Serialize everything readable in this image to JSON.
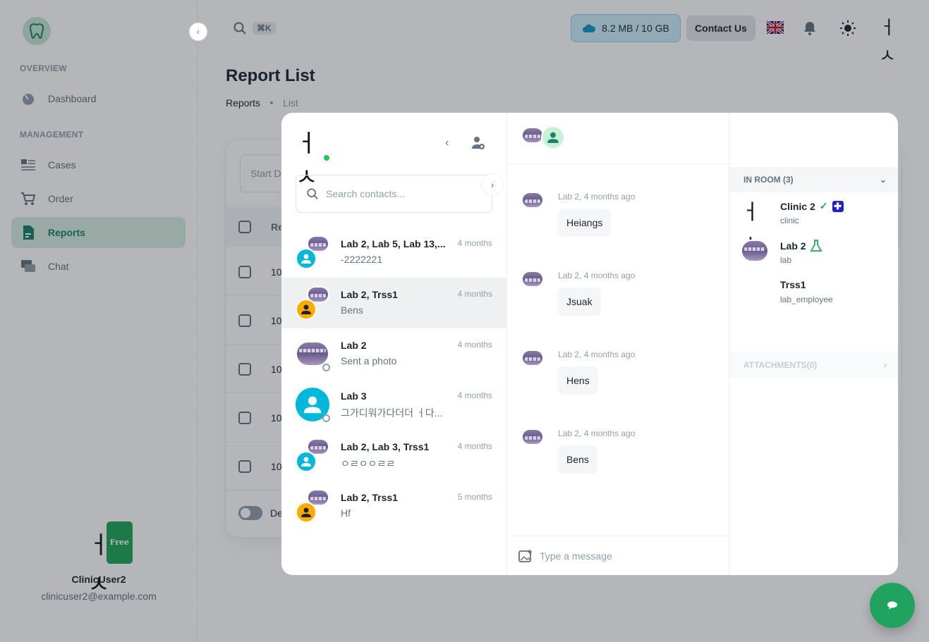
{
  "sidebar": {
    "logo_icon": "tooth-logo-icon",
    "sections": [
      {
        "label": "OVERVIEW"
      },
      {
        "label": "MANAGEMENT"
      }
    ],
    "items": [
      {
        "label": "Dashboard",
        "icon": "dashboard-icon"
      },
      {
        "label": "Cases",
        "icon": "cases-icon"
      },
      {
        "label": "Order",
        "icon": "cart-icon"
      },
      {
        "label": "Reports",
        "icon": "report-icon",
        "active": true
      },
      {
        "label": "Chat",
        "icon": "chat-icon"
      }
    ],
    "user": {
      "name": "ClinicUser2",
      "email": "clinicuser2@example.com",
      "plan_badge": "Free",
      "avatar_text": "ㅓㅅ"
    }
  },
  "topbar": {
    "shortcut": "⌘K",
    "storage": "8.2 MB / 10 GB",
    "contact_label": "Contact Us",
    "avatar_text": "ㅓㅅ"
  },
  "page": {
    "title": "Report List",
    "breadcrumb": [
      "Reports",
      "List"
    ],
    "filter_start_placeholder": "Start D",
    "header_col": "Re",
    "rows": [
      "10",
      "10",
      "10",
      "10",
      "10"
    ],
    "dense_label": "De"
  },
  "chat": {
    "me_avatar_text": "ㅓㅅ",
    "search_placeholder": "Search contacts...",
    "conversations": [
      {
        "name": "Lab 2, Lab 5, Lab 13,...",
        "last": "-2222221",
        "time": "4 months"
      },
      {
        "name": "Lab 2, Trss1",
        "last": "Bens",
        "time": "4 months"
      },
      {
        "name": "Lab 2",
        "last": "Sent a photo",
        "time": "4 months"
      },
      {
        "name": "Lab 3",
        "last": "그가디워가다더더 ㅓ다...",
        "time": "4 months"
      },
      {
        "name": "Lab 2, Lab 3, Trss1",
        "last": "ㅇㄹㅇㅇㄹㄹ",
        "time": "4 months"
      },
      {
        "name": "Lab 2, Trss1",
        "last": "Hf",
        "time": "5 months"
      }
    ],
    "messages": [
      {
        "meta": "Lab 2,  4 months ago",
        "text": "Heiangs"
      },
      {
        "meta": "Lab 2,  4 months ago",
        "text": "Jsuak"
      },
      {
        "meta": "Lab 2,  4 months ago",
        "text": "Hens"
      },
      {
        "meta": "Lab 2,  4 months ago",
        "text": "Bens"
      }
    ],
    "input_placeholder": "Type a message",
    "room": {
      "title": "IN ROOM (3)",
      "members": [
        {
          "name": "Clinic 2",
          "role": "clinic",
          "avatar_text": "ㅓㅅ"
        },
        {
          "name": "Lab 2",
          "role": "lab"
        },
        {
          "name": "Trss1",
          "role": "lab_employee"
        }
      ],
      "attachments": "ATTACHMENTS(0)"
    }
  },
  "colors": {
    "primary": "#1fa35f",
    "accent": "#00b8d9",
    "warning": "#ffab00",
    "active_bg": "#d8ece0"
  }
}
